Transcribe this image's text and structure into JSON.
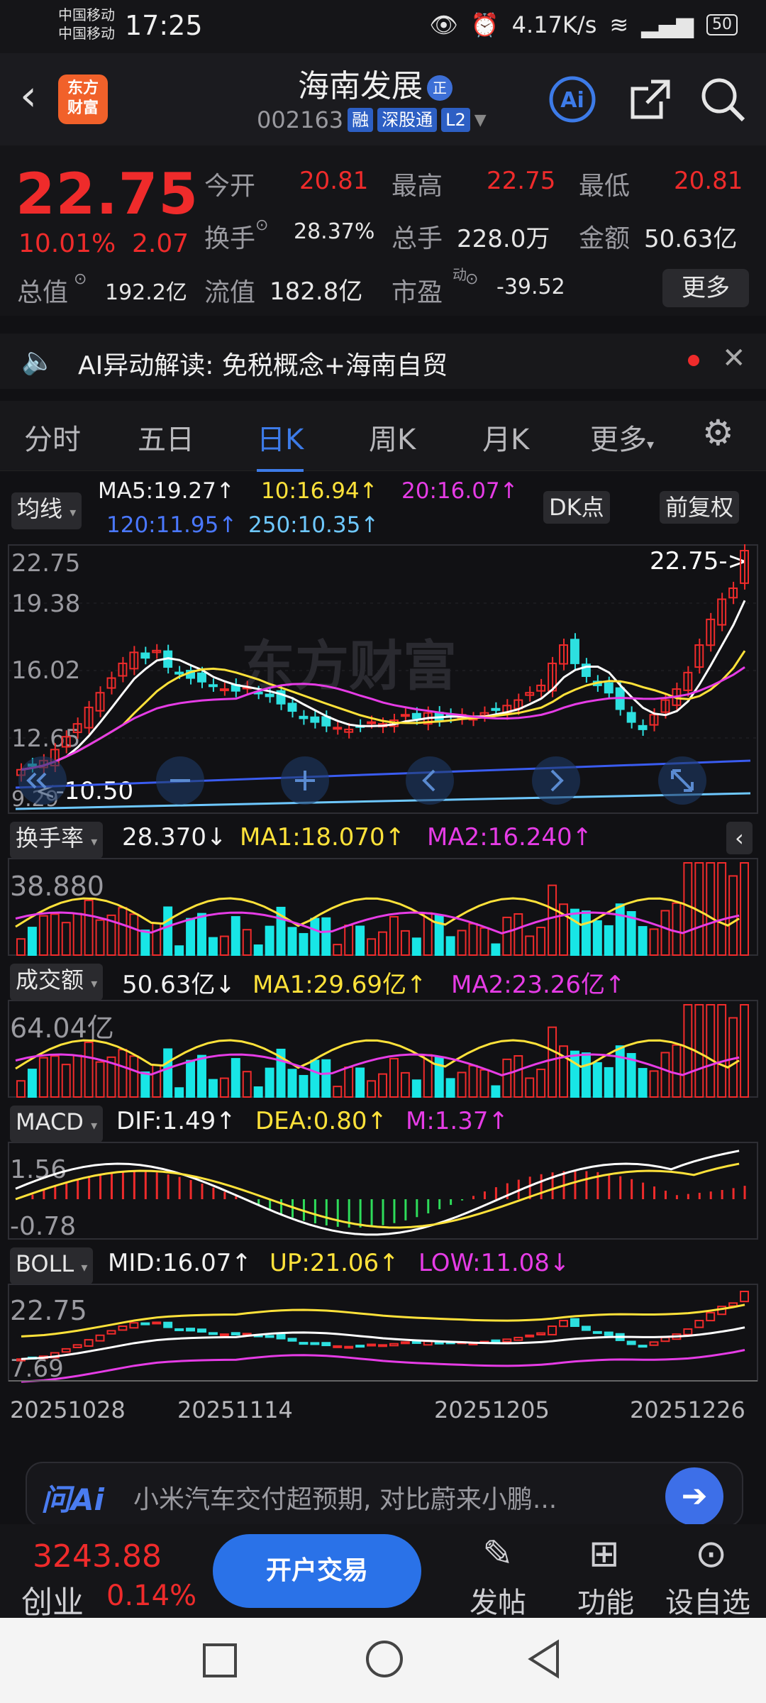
{
  "status": {
    "carrier1": "中国移动",
    "carrier2": "中国移动",
    "time": "17:25",
    "speed": "4.17K/s",
    "battery": "50"
  },
  "header": {
    "logo_line1": "东方",
    "logo_line2": "财富",
    "title": "海南发展",
    "title_badge": "正",
    "code": "002163",
    "tags": [
      "融",
      "深股通",
      "L2"
    ]
  },
  "quote": {
    "price": "22.75",
    "pct": "10.01%",
    "change": "2.07",
    "open_label": "今开",
    "open": "20.81",
    "high_label": "最高",
    "high": "22.75",
    "low_label": "最低",
    "low": "20.81",
    "turnover_label": "换手",
    "turnover": "28.37%",
    "volume_label": "总手",
    "volume": "228.0万",
    "amount_label": "金额",
    "amount": "50.63亿",
    "mktcap_label": "总值",
    "mktcap": "192.2亿",
    "float_label": "流值",
    "float": "182.8亿",
    "pe_label": "市盈",
    "pe_sup": "动",
    "pe": "-39.52",
    "more": "更多"
  },
  "ai_banner": {
    "text": "AI异动解读:  免税概念+海南自贸"
  },
  "tabs": [
    "分时",
    "五日",
    "日K",
    "周K",
    "月K",
    "更多"
  ],
  "active_tab": "日K",
  "ma": {
    "btn": "均线",
    "ma5": "MA5:19.27↑",
    "ma10": "10:16.94↑",
    "ma20": "20:16.07↑",
    "ma120": "120:11.95↑",
    "ma250": "250:10.35↑",
    "dk": "DK点",
    "fq": "前复权"
  },
  "kline": {
    "y_labels": [
      "22.75",
      "19.38",
      "16.02",
      "12.65",
      "9.29"
    ],
    "last_marker": "22.75->",
    "low_marker": "<-10.50",
    "watermark": "东方财富"
  },
  "turnover_panel": {
    "btn": "换手率",
    "value": "28.370↓",
    "ma1": "MA1:18.070↑",
    "ma2": "MA2:16.240↑",
    "ymax": "38.880"
  },
  "amount_panel": {
    "btn": "成交额",
    "value": "50.63亿↓",
    "ma1": "MA1:29.69亿↑",
    "ma2": "MA2:23.26亿↑",
    "ymax": "64.04亿"
  },
  "macd_panel": {
    "btn": "MACD",
    "dif": "DIF:1.49↑",
    "dea": "DEA:0.80↑",
    "m": "M:1.37↑",
    "ymax": "1.56",
    "ymin": "-0.78"
  },
  "boll_panel": {
    "btn": "BOLL",
    "mid": "MID:16.07↑",
    "up": "UP:21.06↑",
    "low": "LOW:11.08↓",
    "ymax": "22.75",
    "ymin": "7.69"
  },
  "dates": [
    "20251028",
    "20251114",
    "20251205",
    "20251226"
  ],
  "ask_banner": {
    "brand": "问Ai",
    "text": "小米汽车交付超预期, 对比蔚来小鹏..."
  },
  "tabbar": {
    "index_value": "3243.88",
    "index_name": "创业",
    "index_pct": "0.14%",
    "open_btn": "开户交易",
    "post": "发帖",
    "func": "功能",
    "custom": "设自选"
  }
}
